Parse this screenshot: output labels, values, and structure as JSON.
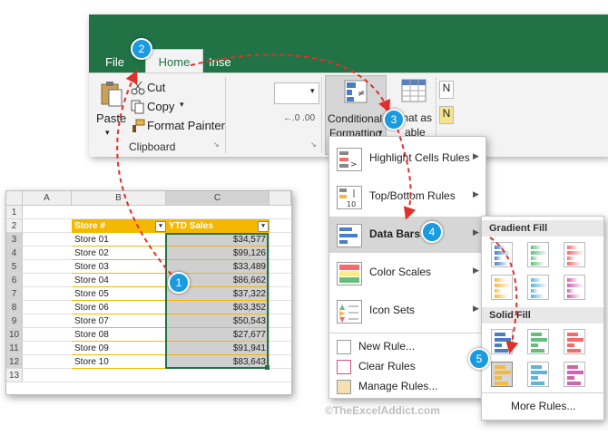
{
  "ribbon": {
    "tabs": {
      "file": "File",
      "home": "Home",
      "insert_partial": "Inse"
    },
    "clipboard": {
      "paste": "Paste",
      "cut": "Cut",
      "copy": "Copy",
      "format_painter": "Format Painter",
      "group_label": "Clipboard"
    },
    "conditional_formatting_line1": "Conditional",
    "conditional_formatting_line2": "Formatting",
    "format_as_table_line1": "mat as",
    "format_as_table_line2": "able",
    "partial_right_top": "N",
    "partial_right_bottom": "N"
  },
  "menu": {
    "highlight_cells": "Highlight Cells Rules",
    "top_bottom": "Top/Bottom Rules",
    "data_bars": "Data Bars",
    "color_scales": "Color Scales",
    "icon_sets": "Icon Sets",
    "new_rule": "New Rule...",
    "clear_rules": "Clear Rules",
    "manage_rules": "Manage Rules..."
  },
  "submenu": {
    "gradient_fill": "Gradient Fill",
    "solid_fill": "Solid Fill",
    "more_rules": "More Rules...",
    "bar_colors": [
      "#4a7ec2",
      "#63be7b",
      "#f8696b",
      "#f5b942",
      "#5fb4d8",
      "#d062b0"
    ]
  },
  "sheet": {
    "col_headers": [
      "A",
      "B",
      "C"
    ],
    "row_numbers": [
      "1",
      "2",
      "3",
      "4",
      "5",
      "6",
      "7",
      "8",
      "9",
      "10",
      "11",
      "12",
      "13"
    ],
    "header_store": "Store #",
    "header_sales": "YTD Sales",
    "rows": [
      {
        "store": "Store 01",
        "sales": "$34,577"
      },
      {
        "store": "Store 02",
        "sales": "$99,126"
      },
      {
        "store": "Store 03",
        "sales": "$33,489"
      },
      {
        "store": "Store 04",
        "sales": "$86,662"
      },
      {
        "store": "Store 05",
        "sales": "$37,322"
      },
      {
        "store": "Store 06",
        "sales": "$63,352"
      },
      {
        "store": "Store 07",
        "sales": "$50,543"
      },
      {
        "store": "Store 08",
        "sales": "$27,677"
      },
      {
        "store": "Store 09",
        "sales": "$91,941"
      },
      {
        "store": "Store 10",
        "sales": "$83,643"
      }
    ]
  },
  "steps": [
    "1",
    "2",
    "3",
    "4",
    "5"
  ],
  "watermark": "©TheExcelAddict.com",
  "colors": {
    "excel_green": "#217346",
    "header_orange": "#f5b800",
    "callout_blue": "#1a9be0",
    "arrow_red": "#e0302a"
  }
}
